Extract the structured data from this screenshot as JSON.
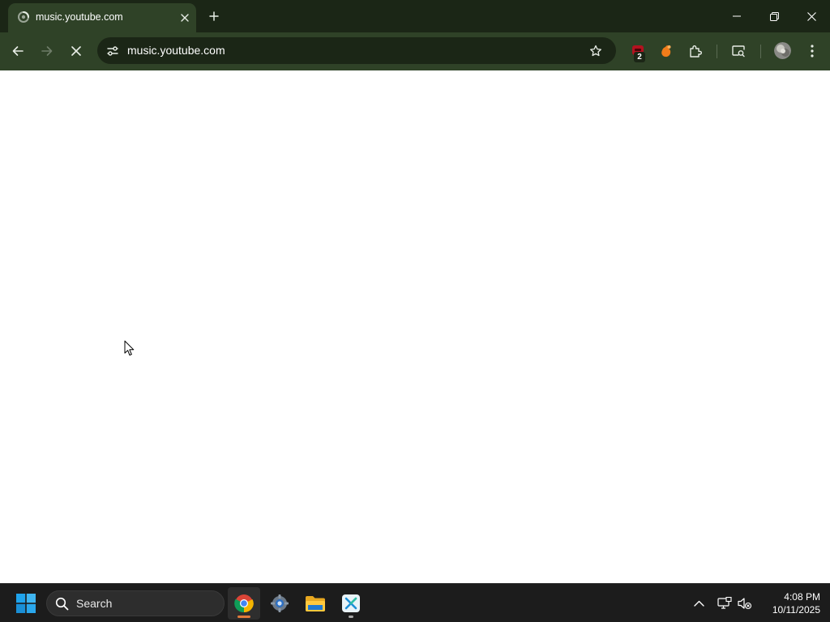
{
  "browser": {
    "tab": {
      "title": "music.youtube.com",
      "favicon": "loading-spinner-icon"
    },
    "new_tab_icon": "plus-icon",
    "window_controls": [
      "minimize-icon",
      "restore-icon",
      "close-icon"
    ],
    "toolbar": {
      "back_icon": "arrow-left-icon",
      "forward_icon": "arrow-right-icon",
      "stop_icon": "close-icon",
      "site_info_icon": "tune-icon",
      "url": "music.youtube.com",
      "bookmark_icon": "star-outline-icon",
      "extensions": [
        {
          "icon": "extension-red-icon",
          "badge": "2"
        },
        {
          "icon": "extension-orange-icon"
        },
        {
          "icon": "puzzle-icon"
        }
      ],
      "tab_search_icon": "tab-search-icon",
      "profile_icon": "avatar-icon",
      "menu_icon": "kebab-menu-icon"
    },
    "colors": {
      "frame": "#1b2616",
      "toolbar": "#2f4227",
      "omnibox": "#1b2616",
      "text": "#ffffff",
      "page_background": "#ffffff"
    }
  },
  "page": {
    "state": "blank loading page"
  },
  "taskbar": {
    "start_icon": "windows-logo-icon",
    "search": {
      "label": "Search",
      "icon": "search-icon"
    },
    "apps": [
      {
        "name": "Google Chrome",
        "icon": "chrome-icon",
        "active": true
      },
      {
        "name": "Settings",
        "icon": "settings-gear-icon",
        "active": false
      },
      {
        "name": "File Explorer",
        "icon": "folder-icon",
        "active": false
      },
      {
        "name": "Remote app",
        "icon": "x-app-icon",
        "active": false
      }
    ],
    "tray": {
      "overflow_icon": "chevron-up-icon",
      "network_icon": "network-icon",
      "volume_icon": "volume-muted-icon"
    },
    "clock": {
      "time": "4:08 PM",
      "date": "10/11/2025"
    },
    "colors": {
      "background": "#1c1c1c",
      "accent": "#e07a3c"
    }
  }
}
